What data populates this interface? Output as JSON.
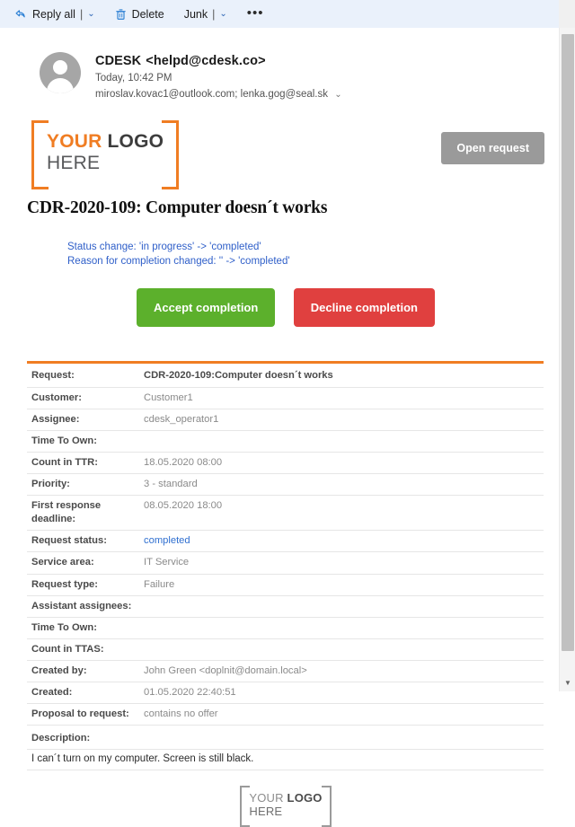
{
  "toolbar": {
    "reply_all": "Reply all",
    "reply_all_icon": "reply-all-icon",
    "delete": "Delete",
    "delete_icon": "trash-icon",
    "junk": "Junk",
    "more": "•••",
    "separator": "|",
    "caret": "⌄"
  },
  "message": {
    "sender_name": "CDESK",
    "sender_email": "<helpd@cdesk.co>",
    "date": "Today, 10:42 PM",
    "recipients": "miroslav.kovac1@outlook.com;  lenka.gog@seal.sk",
    "recipients_expand_icon": "double-chevron-down-icon",
    "avatar_icon": "person-avatar-icon"
  },
  "logo": {
    "line1_a": "YOUR",
    "line1_b": "LOGO",
    "line2": "HERE"
  },
  "body": {
    "open_request_label": "Open request",
    "subject": "CDR-2020-109: Computer doesn´t works",
    "status_change_line1": "Status change: 'in progress' -> 'completed'",
    "status_change_line2": "Reason for completion changed: '' -> 'completed'",
    "accept_label": "Accept completion",
    "decline_label": "Decline completion"
  },
  "details": {
    "rows": [
      {
        "label": "Request:",
        "value": "CDR-2020-109:Computer doesn´t works",
        "style": "strong"
      },
      {
        "label": "Customer:",
        "value": "Customer1",
        "style": "normal"
      },
      {
        "label": "Assignee:",
        "value": "cdesk_operator1",
        "style": "normal"
      },
      {
        "label": "Time To Own:",
        "value": "",
        "style": "normal"
      },
      {
        "label": "Count in TTR:",
        "value": "18.05.2020 08:00",
        "style": "normal"
      },
      {
        "label": "Priority:",
        "value": "3 - standard",
        "style": "normal"
      },
      {
        "label": "First response deadline:",
        "value": "08.05.2020 18:00",
        "style": "normal"
      },
      {
        "label": "Request status:",
        "value": "completed",
        "style": "link"
      },
      {
        "label": "Service area:",
        "value": "IT Service",
        "style": "normal"
      },
      {
        "label": "Request type:",
        "value": "Failure",
        "style": "normal"
      },
      {
        "label": "Assistant assignees:",
        "value": "",
        "style": "normal"
      },
      {
        "label": "Time To Own:",
        "value": "",
        "style": "normal"
      },
      {
        "label": "Count in TTAS:",
        "value": "",
        "style": "normal"
      },
      {
        "label": "Created by:",
        "value": "John Green <doplnit@domain.local>",
        "style": "normal"
      },
      {
        "label": "Created:",
        "value": "01.05.2020 22:40:51",
        "style": "normal"
      },
      {
        "label": "Proposal to request:",
        "value": "contains no offer",
        "style": "normal"
      }
    ],
    "description_label": "Description:",
    "description_text": "I can´t turn on my computer. Screen is still black."
  },
  "scrollbar": {
    "down_arrow_icon": "chevron-down-icon"
  },
  "colors": {
    "accent_orange": "#f07d23",
    "accept_green": "#5cb02c",
    "decline_red": "#e0403f",
    "link_blue": "#2f6fd0",
    "toolbar_blue": "#eaf1fb"
  }
}
